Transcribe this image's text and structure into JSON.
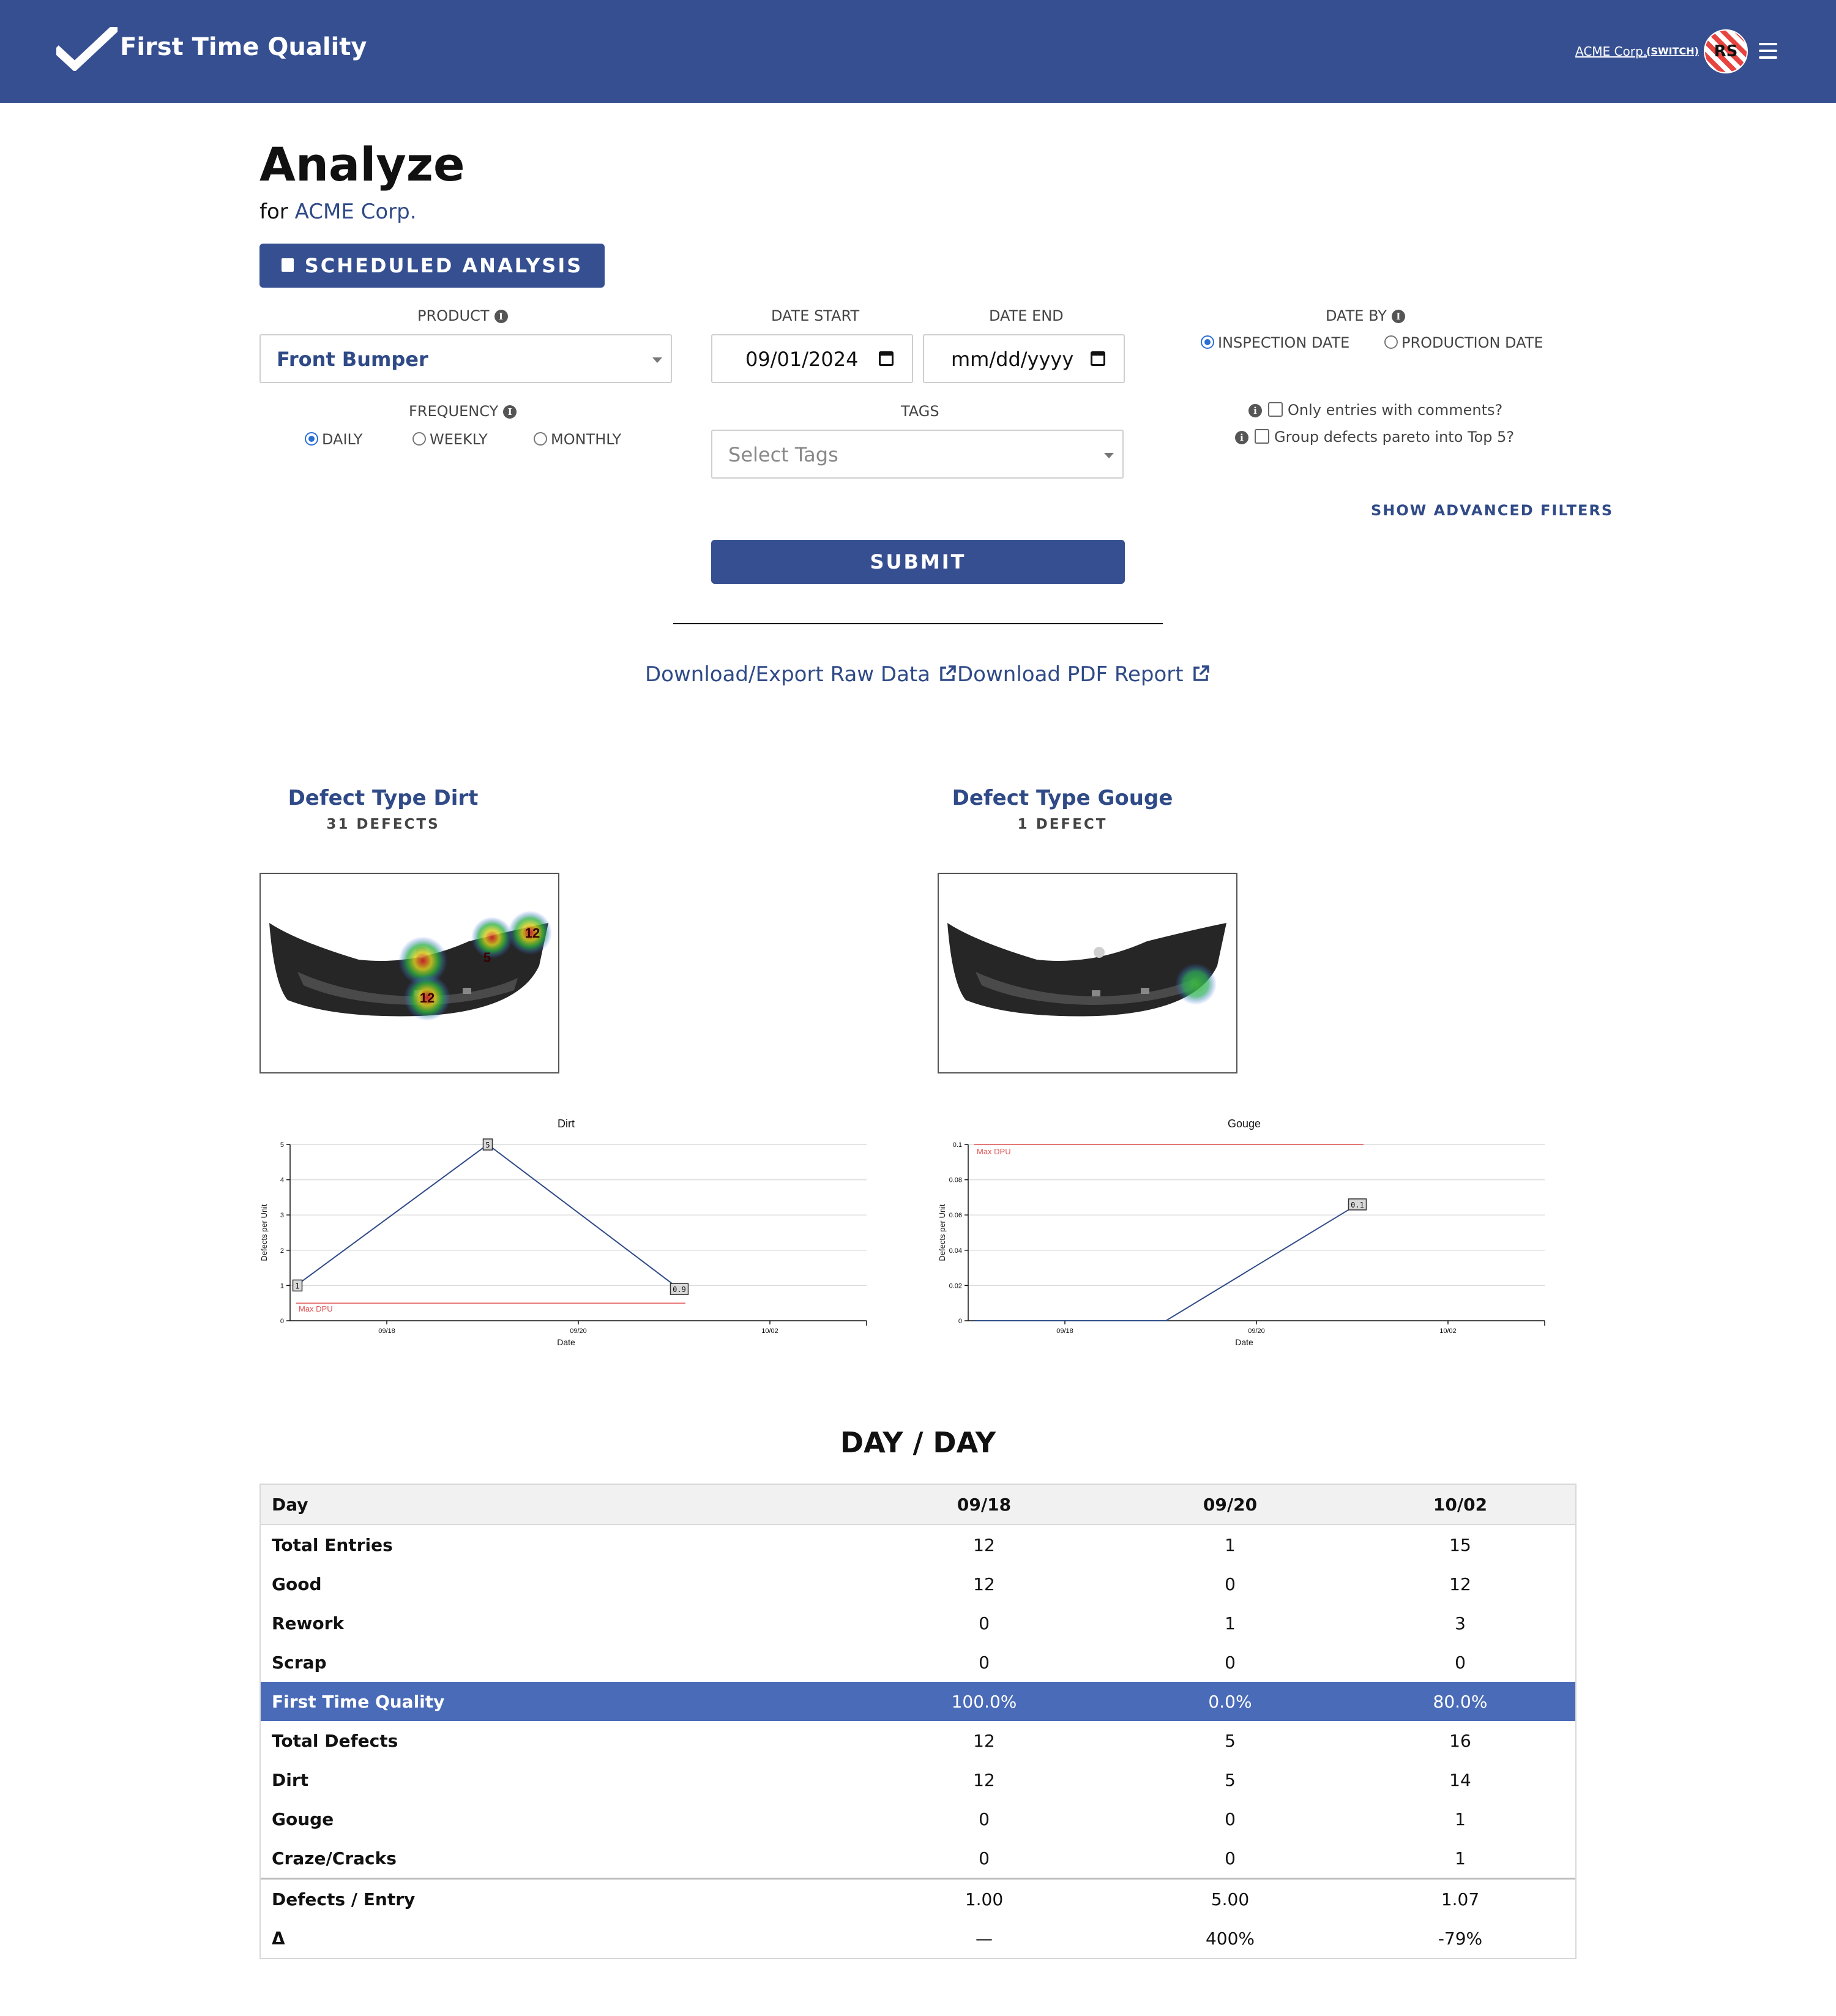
{
  "header": {
    "brand": "First Time Quality",
    "company_link": "ACME Corp.",
    "switch_link": "(SWITCH)",
    "avatar_initials": "RS",
    "colors": {
      "bar": "#354f91",
      "avatar_stripe": "#e9433f"
    },
    "icons": [
      "check-logo-icon",
      "menu-icon"
    ]
  },
  "page": {
    "title": "Analyze",
    "for_label": "for",
    "company": "ACME Corp.",
    "scheduled_button": "SCHEDULED ANALYSIS"
  },
  "filters": {
    "product_label": "PRODUCT",
    "product_value": "Front Bumper",
    "frequency_label": "FREQUENCY",
    "frequency_options": [
      "DAILY",
      "WEEKLY",
      "MONTHLY"
    ],
    "frequency_selected": "DAILY",
    "date_start_label": "DATE START",
    "date_start_value": "09/01/2024",
    "date_end_label": "DATE END",
    "date_end_placeholder": "mm/dd/yyyy",
    "tags_label": "TAGS",
    "tags_placeholder": "Select Tags",
    "date_by_label": "DATE BY",
    "date_by_options": [
      "INSPECTION DATE",
      "PRODUCTION DATE"
    ],
    "date_by_selected": "INSPECTION DATE",
    "comments_checkbox": "Only entries with comments?",
    "pareto_checkbox": "Group defects pareto into Top 5?",
    "advanced_link": "SHOW ADVANCED FILTERS",
    "submit": "SUBMIT"
  },
  "downloads": {
    "raw": "Download/Export Raw Data",
    "pdf": "Download PDF Report"
  },
  "defects": [
    {
      "title": "Defect Type Dirt",
      "count_label": "31 DEFECTS",
      "heat_labels": [
        "12",
        "5",
        "12"
      ]
    },
    {
      "title": "Defect Type Gouge",
      "count_label": "1 DEFECT"
    }
  ],
  "chart_data": [
    {
      "type": "line",
      "title": "Dirt",
      "xlabel": "Date",
      "ylabel": "Defects per Unit",
      "x_ticks": [
        "09/18",
        "09/20",
        "10/02"
      ],
      "y_ticks": [
        "0",
        "1",
        "2",
        "3",
        "4",
        "5"
      ],
      "ylim": [
        0,
        5
      ],
      "series": [
        {
          "x": [
            "09/18",
            "09/20",
            "10/02"
          ],
          "values": [
            1,
            5,
            0.9
          ],
          "labels": [
            "1",
            "5",
            "0.9"
          ]
        }
      ],
      "threshold": {
        "label": "Max DPU",
        "value": 0.5
      },
      "grid": true,
      "colors": {
        "line": "#2f4a87",
        "threshold": "#e05555"
      }
    },
    {
      "type": "line",
      "title": "Gouge",
      "xlabel": "Date",
      "ylabel": "Defects per Unit",
      "x_ticks": [
        "09/18",
        "09/20",
        "10/02"
      ],
      "y_ticks": [
        "0",
        "0.02",
        "0.04",
        "0.06",
        "0.08",
        "0.1"
      ],
      "ylim": [
        0,
        0.1
      ],
      "series": [
        {
          "x": [
            "09/18",
            "09/20",
            "10/02"
          ],
          "values": [
            0,
            0,
            0.066
          ],
          "labels": [
            "0.1"
          ]
        }
      ],
      "threshold": {
        "label": "Max DPU",
        "value": 0.1
      },
      "grid": true,
      "colors": {
        "line": "#2f4a87",
        "threshold": "#e05555"
      }
    }
  ],
  "table": {
    "title": "DAY / DAY",
    "header": [
      "Day",
      "09/18",
      "09/20",
      "10/02"
    ],
    "rows": [
      [
        "Total Entries",
        "12",
        "1",
        "15"
      ],
      [
        "Good",
        "12",
        "0",
        "12"
      ],
      [
        "Rework",
        "0",
        "1",
        "3"
      ],
      [
        "Scrap",
        "0",
        "0",
        "0"
      ],
      [
        "First Time Quality",
        "100.0%",
        "0.0%",
        "80.0%"
      ],
      [
        "Total Defects",
        "12",
        "5",
        "16"
      ],
      [
        "Dirt",
        "12",
        "5",
        "14"
      ],
      [
        "Gouge",
        "0",
        "0",
        "1"
      ],
      [
        "Craze/Cracks",
        "0",
        "0",
        "1"
      ],
      [
        "Defects / Entry",
        "1.00",
        "5.00",
        "1.07"
      ],
      [
        "Δ",
        "—",
        "400%",
        "-79%"
      ]
    ],
    "highlight_color": "#4a6bb8"
  }
}
